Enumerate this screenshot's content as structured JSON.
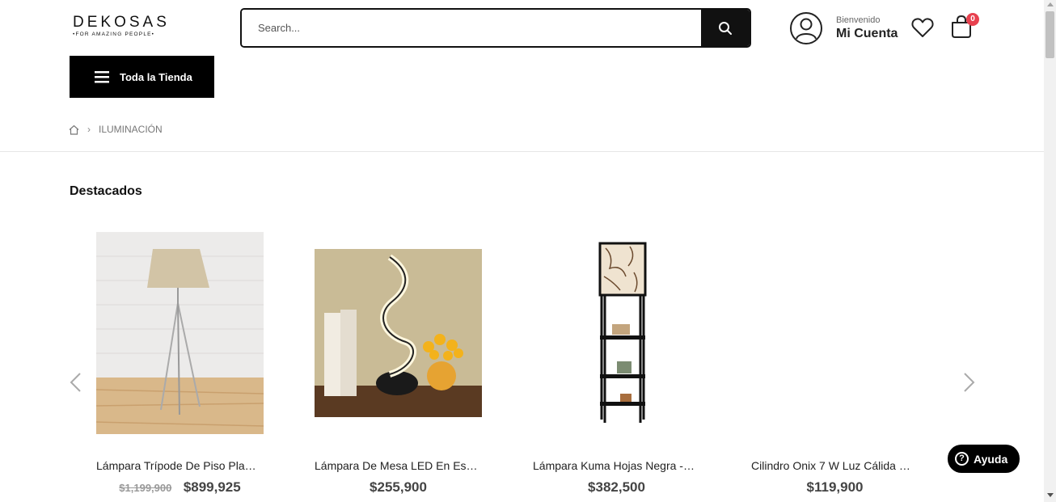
{
  "header": {
    "logo_main": "DEKOSAS",
    "logo_sub": "•FOR AMAZING PEOPLE•",
    "search_placeholder": "Search...",
    "account_greeting": "Bienvenido",
    "account_label": "Mi Cuenta",
    "cart_count": "0",
    "icons": [
      "search-icon",
      "user-icon",
      "heart-icon",
      "shopping-bag-icon"
    ]
  },
  "nav": {
    "store_button": "Toda la Tienda"
  },
  "breadcrumb": {
    "home_icon": "home-icon",
    "current": "ILUMINACIÓN"
  },
  "section": {
    "title": "Destacados"
  },
  "products": [
    {
      "name": "Lámpara Trípode De Piso Pla…",
      "old_price": "$1,199,900",
      "price": "$899,925"
    },
    {
      "name": "Lámpara De Mesa LED En Es…",
      "old_price": "",
      "price": "$255,900"
    },
    {
      "name": "Lámpara Kuma Hojas Negra -…",
      "old_price": "",
      "price": "$382,500"
    },
    {
      "name": "Cilindro Onix 7 W Luz Cálida …",
      "old_price": "",
      "price": "$119,900"
    }
  ],
  "help_button": "Ayuda",
  "colors": {
    "primary": "#000000",
    "badge": "#e8414f",
    "price": "#444444",
    "old_price": "#999999"
  }
}
